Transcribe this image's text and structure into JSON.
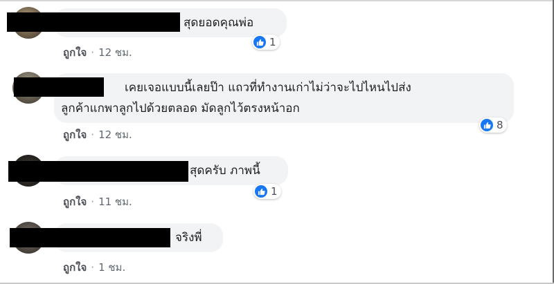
{
  "comments": [
    {
      "text": "สุดยอดคุณพ่อ",
      "reaction_count": "1",
      "like_label": "ถูกใจ",
      "separator": "·",
      "time": "12 ชม."
    },
    {
      "text_line1": "เคยเจอแบบนี้เลยป๊า แถวที่ทำงานเก่าไม่ว่าจะไปไหนไปส่ง",
      "text_line2": "ลูกค้าแกพาลูกไปด้วยตลอด มัดลูกไว้ตรงหน้าอก",
      "reaction_count": "8",
      "like_label": "ถูกใจ",
      "separator": "·",
      "time": "12 ชม."
    },
    {
      "text": "สุดครับ ภาพนี้",
      "reaction_count": "1",
      "like_label": "ถูกใจ",
      "separator": "·",
      "time": "11 ชม."
    },
    {
      "text": "จริงพี่",
      "like_label": "ถูกใจ",
      "separator": "·",
      "time": "1 ชม."
    }
  ],
  "icons": {
    "reaction": "like-thumb-icon"
  },
  "colors": {
    "bubble": "#f2f3f5",
    "like_blue": "#1877f2",
    "redaction": "#000000",
    "meta_text": "#606770"
  }
}
